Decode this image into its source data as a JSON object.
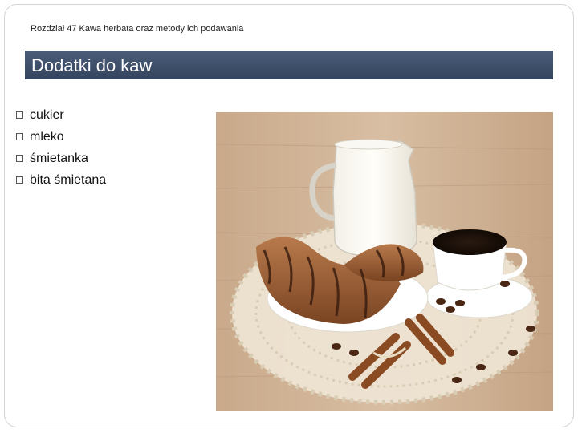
{
  "slide": {
    "chapter": "Rozdział 47 Kawa herbata oraz metody ich podawania",
    "title": "Dodatki do kaw",
    "bullets": [
      {
        "label": "cukier"
      },
      {
        "label": "mleko"
      },
      {
        "label": "śmietanka"
      },
      {
        "label": "bita śmietana"
      }
    ]
  },
  "photo": {
    "icon": "coffee-milk-croissant-photo"
  }
}
